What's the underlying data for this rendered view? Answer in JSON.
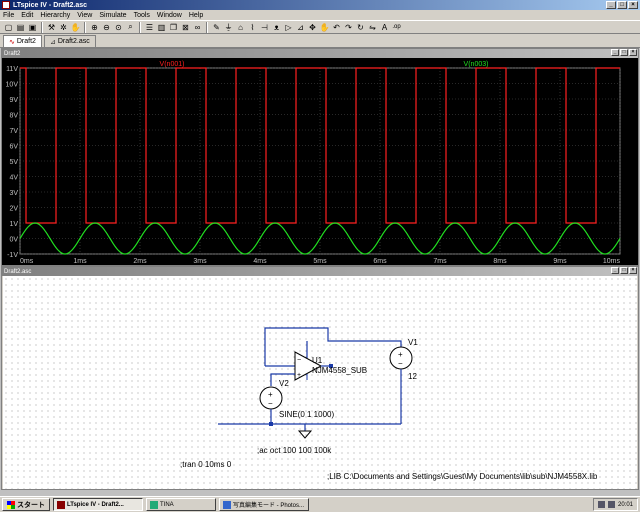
{
  "window": {
    "title": "LTspice IV - Draft2.asc"
  },
  "menu": [
    "File",
    "Edit",
    "Hierarchy",
    "View",
    "Simulate",
    "Tools",
    "Window",
    "Help"
  ],
  "toolbar_icons": [
    "new-icon",
    "open-icon",
    "save-icon",
    "sep",
    "control-panel-icon",
    "run-icon",
    "halt-icon",
    "sep",
    "zoom-in-icon",
    "zoom-out-icon",
    "zoom-fit-icon",
    "zoom-area-icon",
    "sep",
    "tile-h-icon",
    "tile-v-icon",
    "cascade-icon",
    "close-all-icon",
    "binoculars-icon",
    "sep",
    "wire-icon",
    "ground-icon",
    "label-icon",
    "resistor-icon",
    "capacitor-icon",
    "inductor-icon",
    "diode-icon",
    "component-icon",
    "move-icon",
    "drag-icon",
    "undo-icon",
    "redo-icon",
    "rotate-icon",
    "mirror-icon",
    "text-icon",
    "spice-directive-icon"
  ],
  "tabs": [
    {
      "label": "Draft2",
      "icon": "waveform-tab-icon"
    },
    {
      "label": "Draft2.asc",
      "icon": "schematic-tab-icon"
    }
  ],
  "plot_window": {
    "title": "Draft2"
  },
  "schematic_window": {
    "title": "Draft2.asc"
  },
  "chart_data": {
    "type": "line",
    "x_unit": "ms",
    "xlim": [
      0,
      10
    ],
    "ylim": [
      -1,
      11
    ],
    "x_ticks": [
      "0ms",
      "1ms",
      "2ms",
      "3ms",
      "4ms",
      "5ms",
      "6ms",
      "7ms",
      "8ms",
      "9ms",
      "10ms"
    ],
    "y_ticks": [
      "-1V",
      "0V",
      "1V",
      "2V",
      "3V",
      "4V",
      "5V",
      "6V",
      "7V",
      "8V",
      "9V",
      "10V",
      "11V"
    ],
    "grid": true,
    "series": [
      {
        "name": "V(n001)",
        "color": "#ff2020",
        "shape": "square",
        "low": 1.0,
        "high": 11.0,
        "period_ms": 1.0,
        "rise_edges_ms": [
          0.6,
          1.6,
          2.6,
          3.6,
          4.6,
          5.6,
          6.6,
          7.6,
          8.6,
          9.6
        ],
        "fall_edges_ms": [
          0.1,
          1.1,
          2.1,
          3.1,
          4.1,
          5.1,
          6.1,
          7.1,
          8.1,
          9.1
        ]
      },
      {
        "name": "V(n003)",
        "color": "#20e020",
        "shape": "sine",
        "offset": 0.0,
        "amplitude": 1.0,
        "frequency_hz": 1000
      }
    ]
  },
  "schematic": {
    "opamp_ref": "U1",
    "opamp_model": "NJM4558_SUB",
    "v1_ref": "V1",
    "v1_value": "12",
    "v2_ref": "V2",
    "v2_value": "SINE(0 1 1000)",
    "directive_ac": ";ac oct 100 100 100k",
    "directive_tran": ";tran 0 10ms 0",
    "directive_lib": ";LIB C:\\Documents and Settings\\Guest\\My Documents\\lib\\sub\\NJM4558X.lib"
  },
  "taskbar": {
    "start_label": "スタート",
    "tasks": [
      {
        "label": "LTspice IV - Draft2...",
        "icon": "ltspice-task-icon",
        "pressed": true
      },
      {
        "label": "TINA",
        "icon": "tina-task-icon",
        "pressed": false
      },
      {
        "label": "写真編集モード - Photos...",
        "icon": "photo-task-icon",
        "pressed": false
      }
    ],
    "clock": "20:01"
  }
}
